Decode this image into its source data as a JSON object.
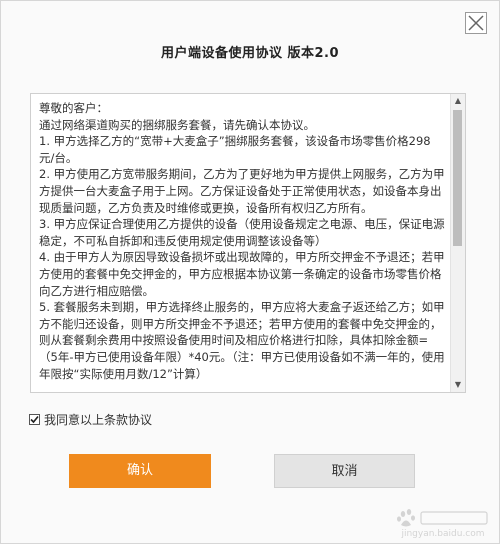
{
  "dialog": {
    "title": "用户端设备使用协议 版本2.0",
    "close_icon": "close-icon"
  },
  "agreement": {
    "paragraphs": [
      "尊敬的客户：",
      "通过网络渠道购买的捆绑服务套餐，请先确认本协议。",
      "1. 甲方选择乙方的“宽带+大麦盒子”捆绑服务套餐，该设备市场零售价格298元/台。",
      "2. 甲方使用乙方宽带服务期间，乙方为了更好地为甲方提供上网服务，乙方为甲方提供一台大麦盒子用于上网。乙方保证设备处于正常使用状态，如设备本身出现质量问题，乙方负责及时维修或更换，设备所有权归乙方所有。",
      "3. 甲方应保证合理使用乙方提供的设备（使用设备规定之电源、电压，保证电源稳定，不可私自拆卸和违反使用规定使用调整该设备等）",
      "4. 由于甲方人为原因导致设备损坏或出现故障的，甲方所交押金不予退还；若甲方使用的套餐中免交押金的，甲方应根据本协议第一条确定的设备市场零售价格向乙方进行相应赔偿。",
      "5. 套餐服务未到期，甲方选择终止服务的，甲方应将大麦盒子返还给乙方；如甲方不能归还设备，则甲方所交押金不予退还；若甲方使用的套餐中免交押金的，则从套餐剩余费用中按照设备使用时间及相应价格进行扣除，具体扣除金额=（5年-甲方已使用设备年限）*40元。（注：甲方已使用设备如不满一年的，使用年限按“实际使用月数/12”计算）"
    ]
  },
  "agree_checkbox": {
    "label": "我同意以上条款协议",
    "checked": true
  },
  "buttons": {
    "confirm_label": "确认",
    "cancel_label": "取消"
  },
  "colors": {
    "confirm_bg": "#f08a1d",
    "cancel_bg": "#e4e4e4"
  },
  "watermark": {
    "url": "jingyan.baidu.com"
  }
}
